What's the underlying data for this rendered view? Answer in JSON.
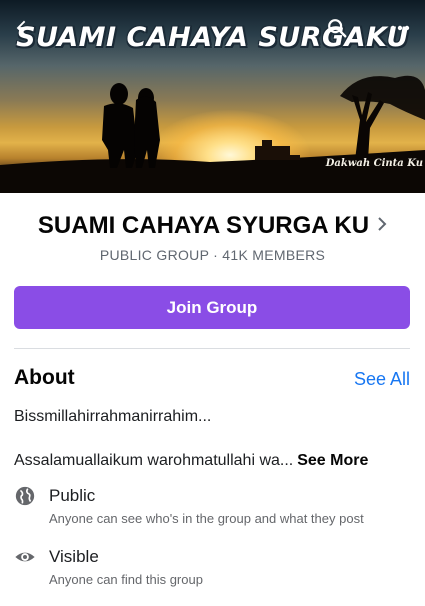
{
  "cover": {
    "title": "SUAMI CAHAYA SURGAKU",
    "signature": "Dakwah Cinta Ku"
  },
  "header_icons": [
    "back-arrow-icon",
    "search-icon",
    "more-dots-icon"
  ],
  "group": {
    "name": "SUAMI CAHAYA SYURGA KU",
    "meta": "PUBLIC GROUP · 41K MEMBERS"
  },
  "join_button": {
    "label": "Join Group",
    "color": "#8a4de6"
  },
  "about": {
    "heading": "About",
    "see_all": "See All",
    "description_line1": "Bissmillahirrahmanirrahim...",
    "description_line2": "Assalamuallaikum warohmatullahi wa...",
    "see_more": "See More",
    "privacy": {
      "icon": "globe-icon",
      "title": "Public",
      "subtitle": "Anyone can see who's in the group and what they post"
    },
    "visibility": {
      "icon": "eye-icon",
      "title": "Visible",
      "subtitle": "Anyone can find this group"
    }
  },
  "colors": {
    "accent": "#8a4de6",
    "link": "#1877f2",
    "secondary_text": "#65676b"
  }
}
